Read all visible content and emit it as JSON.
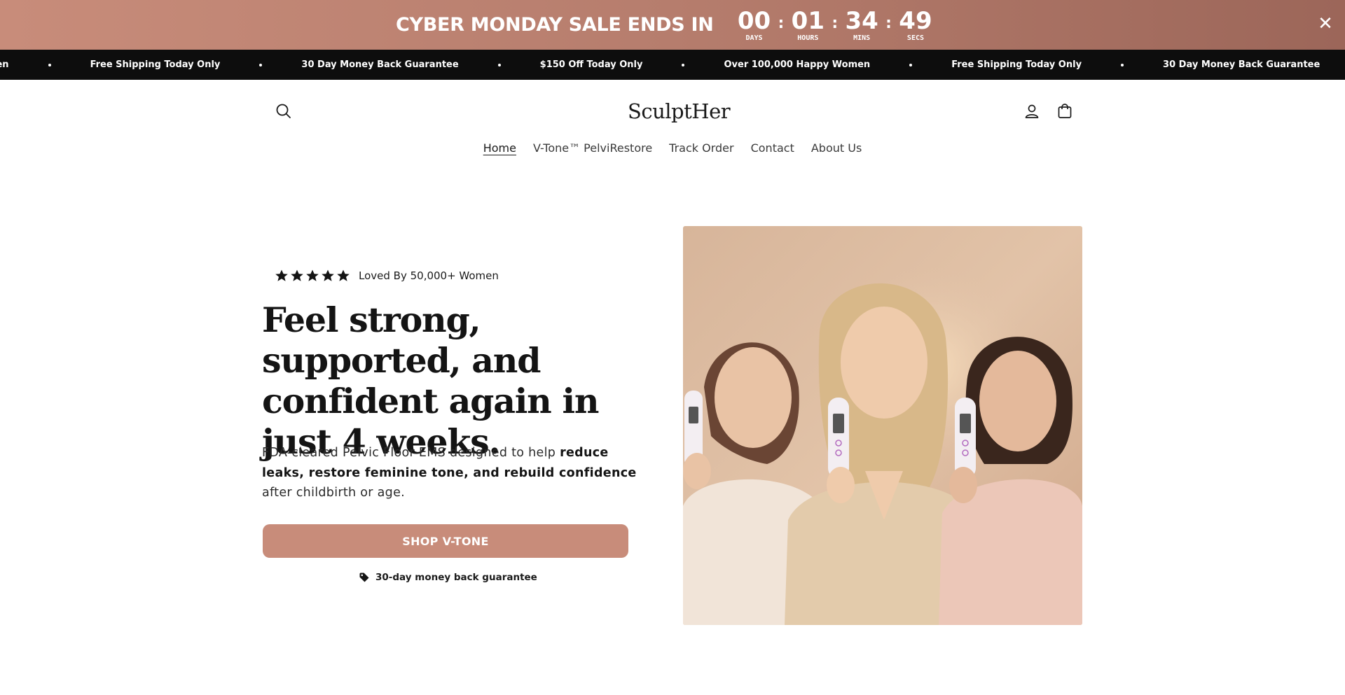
{
  "announcement": {
    "sale_text": "CYBER MONDAY SALE ENDS IN",
    "timer": [
      {
        "value": "00",
        "label": "DAYS"
      },
      {
        "value": "01",
        "label": "HOURS"
      },
      {
        "value": "34",
        "label": "MINS"
      },
      {
        "value": "49",
        "label": "SECS"
      }
    ],
    "separator": ":",
    "close_glyph": "✕"
  },
  "ticker": {
    "items": [
      "omen",
      "Free Shipping Today Only",
      "30 Day Money Back Guarantee",
      "$150 Off Today Only",
      "Over 100,000 Happy Women",
      "Free Shipping Today Only",
      "30 Day Money Back Guarantee"
    ]
  },
  "header": {
    "logo": "SculptHer",
    "icons": {
      "search": "search-icon",
      "account": "user-icon",
      "cart": "cart-icon"
    },
    "nav": [
      {
        "label": "Home",
        "active": true
      },
      {
        "label": "V-Tone™ PelviRestore",
        "active": false
      },
      {
        "label": "Track Order",
        "active": false
      },
      {
        "label": "Contact",
        "active": false
      },
      {
        "label": "About Us",
        "active": false
      }
    ]
  },
  "hero": {
    "rating_text": "Loved By 50,000+ Women",
    "stars": 5,
    "headline": "Feel strong, supported, and confident again in just 4 weeks.",
    "subcopy": {
      "part1": "FDA-cleared Pelvic Floor EMS designed to help ",
      "bold": "reduce leaks, restore feminine tone, and rebuild confidence",
      "part2": " after childbirth or age."
    },
    "cta_label": "SHOP V-TONE",
    "guarantee_text": "30-day money back guarantee",
    "image_alt": "Three women holding pelvic floor EMS devices"
  },
  "colors": {
    "brand": "#c88c7a",
    "ticker_bg": "#0d0d0d",
    "text": "#1a1a1a"
  }
}
